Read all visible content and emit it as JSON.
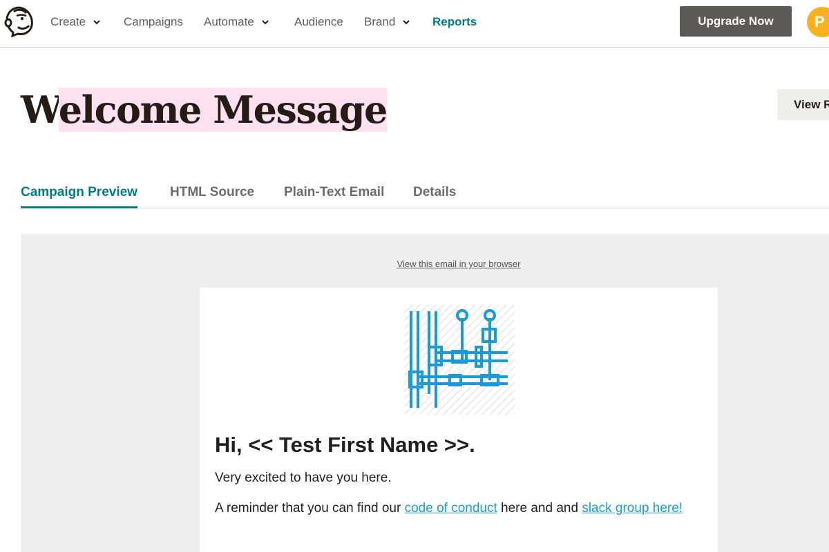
{
  "nav": {
    "items": [
      {
        "label": "Create",
        "has_dropdown": true
      },
      {
        "label": "Campaigns",
        "has_dropdown": false
      },
      {
        "label": "Automate",
        "has_dropdown": true
      },
      {
        "label": "Audience",
        "has_dropdown": false
      },
      {
        "label": "Brand",
        "has_dropdown": true
      },
      {
        "label": "Reports",
        "has_dropdown": false,
        "active": true
      }
    ],
    "upgrade_label": "Upgrade Now",
    "avatar_initial": "P",
    "logo_icon": "mailchimp-freddie-logo-icon"
  },
  "page": {
    "title_first_letter": "W",
    "title_rest": "elcome Message",
    "view_button_label": "View R"
  },
  "tabs": [
    {
      "label": "Campaign Preview",
      "active": true
    },
    {
      "label": "HTML Source",
      "active": false
    },
    {
      "label": "Plain-Text Email",
      "active": false
    },
    {
      "label": "Details",
      "active": false
    }
  ],
  "preview": {
    "browser_link": "View this email in your browser",
    "hero_icon": "pipes-valves-illustration-icon",
    "greeting": "Hi, << Test First Name >>.",
    "paragraph1": "Very excited to have you here.",
    "paragraph2_prefix": "A reminder that you can find our ",
    "link1": "code of conduct",
    "paragraph2_middle": " here and and ",
    "link2": "slack group here!"
  },
  "colors": {
    "accent": "#007c89",
    "upgrade_bg": "#5d5a55",
    "avatar_bg": "#f9b11f",
    "highlight": "#ffe1f2",
    "link": "#1a9bcf",
    "preview_bg": "#efefef"
  }
}
